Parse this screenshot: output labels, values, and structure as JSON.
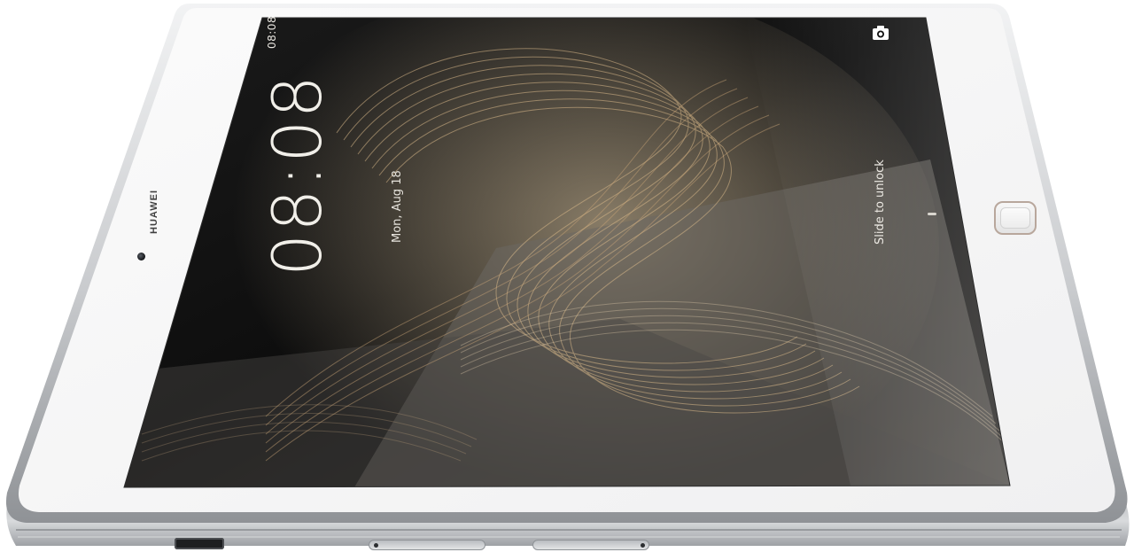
{
  "screen": {
    "status_bar": {
      "text": "08:08"
    },
    "lock_screen": {
      "clock": "08:08",
      "date": "Mon, Aug 18",
      "unlock_hint": "Slide to unlock"
    },
    "icons": {
      "camera": "camera-icon"
    }
  },
  "bezel": {
    "brand": "HUAWEI"
  },
  "colors": {
    "bezel": "#f4f4f4",
    "frame": "#c8cacd",
    "screen_dark": "#121212",
    "wave_gold": "#d9b98a",
    "fingerprint_ring": "#b8a79c"
  }
}
